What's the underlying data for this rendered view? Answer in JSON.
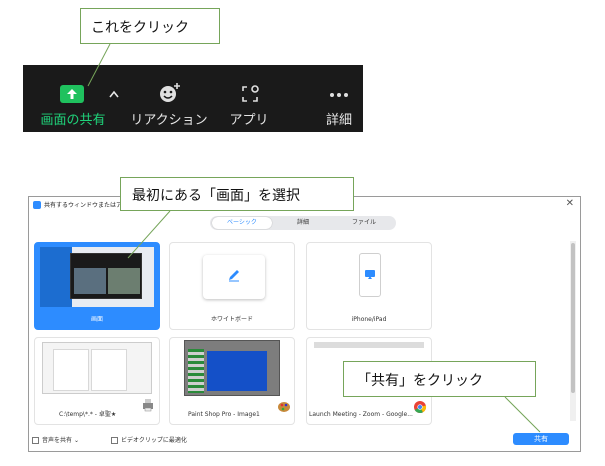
{
  "callouts": {
    "click_this": "これをクリック",
    "select_screen": "最初にある「画面」を選択",
    "click_share": "「共有」をクリック"
  },
  "toolbar": {
    "items": [
      {
        "label": "画面の共有",
        "icon": "share-screen-icon"
      },
      {
        "label": "リアクション",
        "icon": "reaction-icon"
      },
      {
        "label": "アプリ",
        "icon": "apps-icon"
      },
      {
        "label": "詳細",
        "icon": "more-icon"
      }
    ],
    "share_color": "#1fc15e"
  },
  "share_window": {
    "title": "共有するウィンドウまたはアプリケ",
    "tabs": [
      "ベーシック",
      "詳細",
      "ファイル"
    ],
    "active_tab": "ベーシック",
    "tiles": [
      {
        "label": "画面",
        "selected": true
      },
      {
        "label": "ホワイトボード",
        "selected": false
      },
      {
        "label": "iPhone/iPad",
        "selected": false
      },
      {
        "label": "C:\\temp\\*.* - 卓聖★",
        "selected": false
      },
      {
        "label": "Paint Shop Pro - Image1",
        "selected": false
      },
      {
        "label": "Launch Meeting - Zoom - Google...",
        "selected": false
      }
    ],
    "options": {
      "share_audio": "音声を共有",
      "optimize_video": "ビデオクリップに最適化"
    },
    "share_button": "共有",
    "accent_color": "#2d8cff"
  }
}
